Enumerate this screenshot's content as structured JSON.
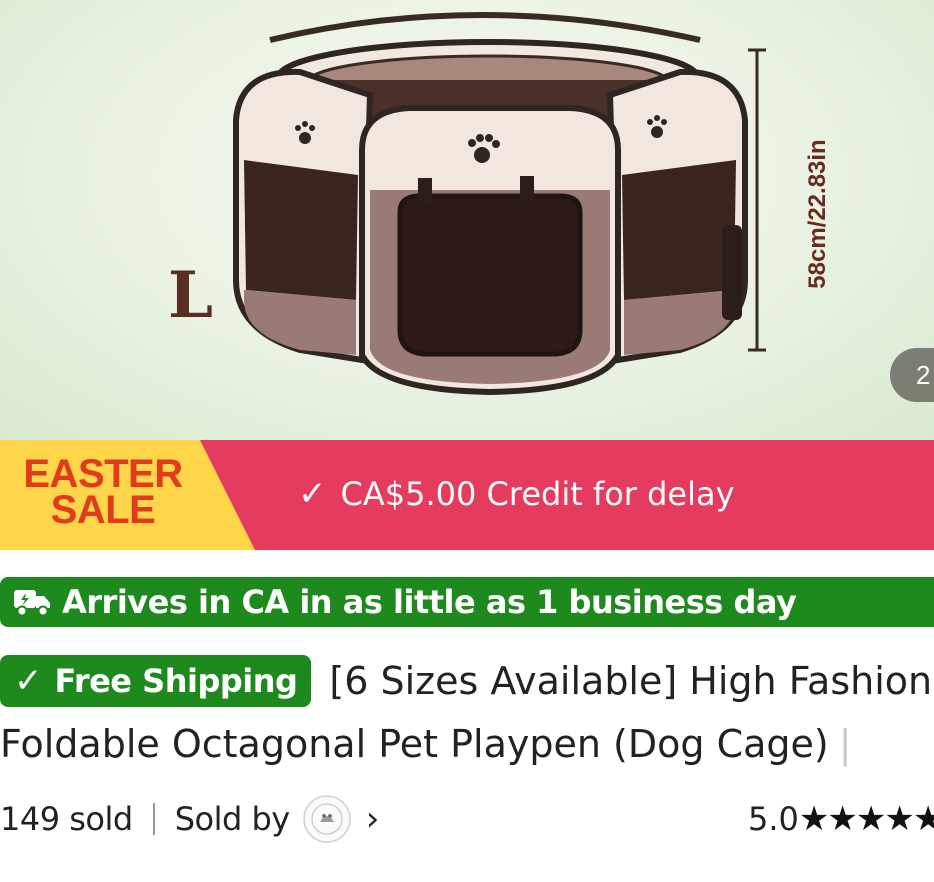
{
  "hero": {
    "size_letter": "L",
    "dimension_label": "58cm/22.83in",
    "page_counter": "2"
  },
  "sale_banner": {
    "badge_line1": "EASTER",
    "badge_line2": "SALE",
    "credit_text": "CA$5.00 Credit for delay",
    "colors": {
      "banner": "#e53b5f",
      "badge": "#ffd54a",
      "badge_text": "#e23a1c"
    }
  },
  "arrival": {
    "text": "Arrives in CA in as little as 1 business day",
    "icon": "fast-truck-icon",
    "color": "#1e8a1e"
  },
  "product": {
    "free_shipping_label": "Free Shipping",
    "title_line1": "[6 Sizes Available] High Fashion",
    "title_line2": "Foldable Octagonal Pet Playpen (Dog Cage)",
    "title_separator": "|"
  },
  "meta": {
    "sold_count": "149 sold",
    "sold_by_label": "Sold by",
    "rating_value": "5.0",
    "rating_stars": 5
  }
}
